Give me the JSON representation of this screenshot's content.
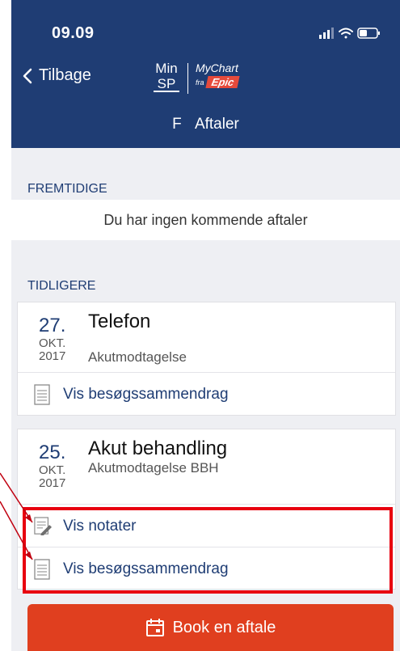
{
  "status": {
    "time": "09.09"
  },
  "nav": {
    "back_label": "Tilbage"
  },
  "logo": {
    "min": "Min",
    "sp": "SP",
    "mychart": "MyChart",
    "fra": "fra",
    "epic": "Epic"
  },
  "page": {
    "initial": "F",
    "title": "Aftaler"
  },
  "upcoming": {
    "header": "FREMTIDIGE",
    "empty_text": "Du har ingen kommende aftaler"
  },
  "past": {
    "header": "TIDLIGERE",
    "appointments": [
      {
        "day": "27.",
        "month": "OKT.",
        "year": "2017",
        "title": "Telefon",
        "department": "Akutmodtagelse",
        "links": [
          {
            "label": "Vis besøgssammendrag",
            "icon": "document-icon"
          }
        ]
      },
      {
        "day": "25.",
        "month": "OKT.",
        "year": "2017",
        "title": "Akut behandling",
        "department": "Akutmodtagelse BBH",
        "links": [
          {
            "label": "Vis notater",
            "icon": "note-pencil-icon"
          },
          {
            "label": "Vis besøgssammendrag",
            "icon": "document-icon"
          }
        ]
      }
    ]
  },
  "book_button": {
    "label": "Book en aftale",
    "icon": "calendar-icon"
  },
  "colors": {
    "header_bg": "#1f3d74",
    "accent_link": "#1f3d74",
    "button_bg": "#e03f1f",
    "highlight_border": "#e8000f"
  }
}
